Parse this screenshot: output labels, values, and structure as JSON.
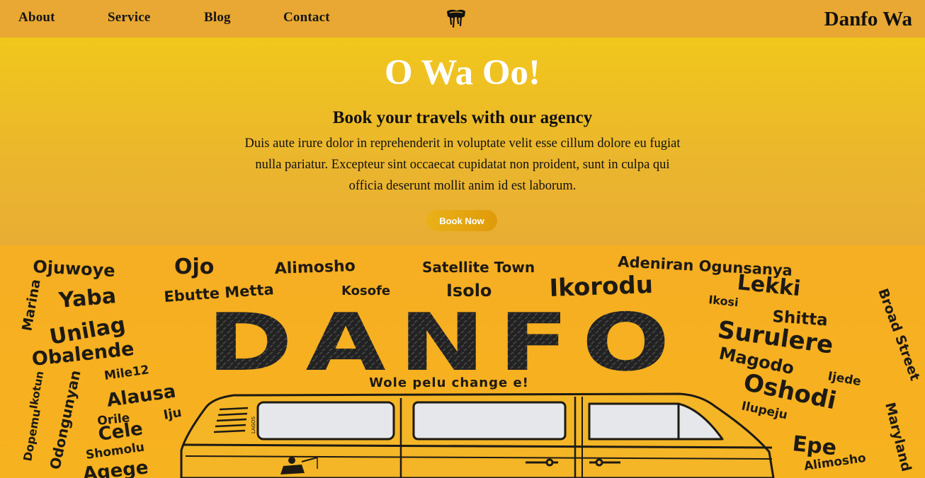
{
  "nav": {
    "links": [
      "About",
      "Service",
      "Blog",
      "Contact"
    ],
    "brand": "Danfo Wa",
    "logo_icon": "danfo-logo-icon",
    "background": "#e8a833"
  },
  "hero": {
    "headline": "O Wa Oo!",
    "subheading": "Book your travels with our agency",
    "body": "Duis aute irure dolor in reprehenderit in voluptate velit esse cillum dolore eu fugiat nulla pariatur. Excepteur sint occaecat cupidatat non proident, sunt in culpa qui officia deserunt mollit anim id est laborum.",
    "button_label": "Book Now",
    "accent": "#f1c71c"
  },
  "banner": {
    "title": "DANFO",
    "tagline": "Wole pelu change e!",
    "places": [
      "Ojuwoye",
      "Ojo",
      "Alimosho",
      "Satellite Town",
      "Adeniran Ogunsanya",
      "Yaba",
      "Ebutte Metta",
      "Kosofe",
      "Isolo",
      "Ikorodu",
      "Lekki",
      "Marina",
      "Unilag",
      "Ikosi",
      "Shitta",
      "Broad Street",
      "Obalende",
      "Surulere",
      "Mile12",
      "Magodo",
      "Ijede",
      "Ikotun",
      "Alausa",
      "Oshodi",
      "Orile",
      "Iju",
      "Ilupeju",
      "Dopemu",
      "Odongunyan",
      "Cele",
      "Shomolu",
      "Epe",
      "Maryland",
      "Alimosho",
      "Agege"
    ],
    "van_plate": "LAGOS",
    "background": "#f5ac22"
  }
}
